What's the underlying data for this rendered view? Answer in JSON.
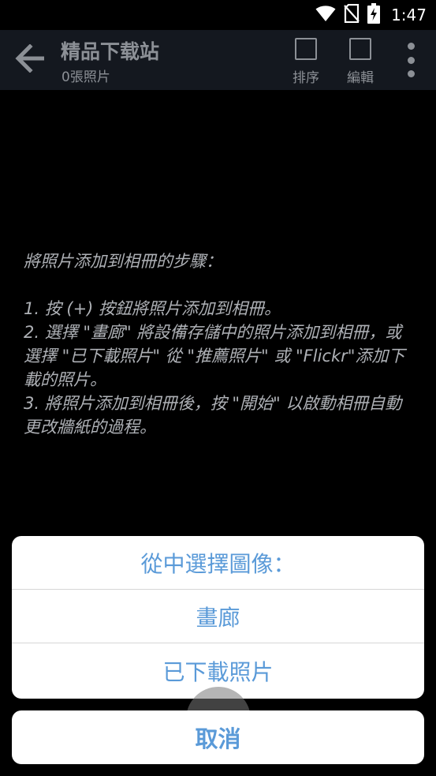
{
  "status_bar": {
    "time": "1:47",
    "icons": [
      "wifi-icon",
      "no-sim-icon",
      "battery-charging-icon"
    ]
  },
  "app_bar": {
    "back_icon": "arrow-left-icon",
    "title": "精品下载站",
    "subtitle": "0張照片",
    "actions": [
      {
        "label": "排序",
        "icon": "checkbox-outline-icon"
      },
      {
        "label": "編輯",
        "icon": "checkbox-outline-icon"
      }
    ],
    "overflow_icon": "more-vertical-icon"
  },
  "instructions": {
    "heading": "將照片添加到相冊的步驟：",
    "step1": "1. 按 (+) 按鈕將照片添加到相冊。",
    "step2": "2. 選擇 \"畫廊\" 將設備存儲中的照片添加到相冊，或選擇 \"已下載照片\" 從 \"推薦照片\" 或 \"Flickr\"添加下載的照片。",
    "step3": "3. 將照片添加到相冊後，按 \"開始\" 以啟動相冊自動更改牆紙的過程。"
  },
  "sheet": {
    "title": "從中選擇圖像：",
    "options": [
      "畫廊",
      "已下載照片"
    ],
    "cancel": "取消"
  },
  "colors": {
    "accent": "#5a9ad8",
    "app_bar": "#14181f",
    "muted_text": "#8c9096"
  }
}
